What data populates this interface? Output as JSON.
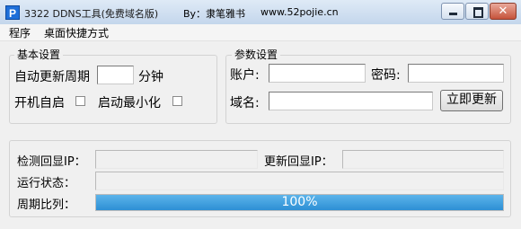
{
  "window": {
    "icon_letter": "P",
    "title": "3322 DDNS工具(免费域名版)",
    "author": "By：隶笔雅书",
    "url": "www.52pojie.cn",
    "close_glyph": "✕"
  },
  "menu": {
    "items": [
      "程序",
      "桌面快捷方式"
    ]
  },
  "basic": {
    "title": "基本设置",
    "update_period_label": "自动更新周期",
    "update_period_value": "",
    "minute_unit": "分钟",
    "autostart_label": "开机自启",
    "autostart_checked": false,
    "minimize_label": "启动最小化",
    "minimize_checked": false
  },
  "params": {
    "title": "参数设置",
    "account_label": "账户:",
    "account_value": "",
    "password_label": "密码:",
    "password_value": "",
    "domain_label": "域名:",
    "domain_value": "",
    "update_button": "立即更新"
  },
  "status": {
    "detect_ip_label": "检测回显IP：",
    "detect_ip_value": "",
    "update_ip_label": "更新回显IP：",
    "update_ip_value": "",
    "run_status_label": "运行状态：",
    "run_status_value": "",
    "period_ratio_label": "周期比列：",
    "progress_text": "100%",
    "progress_percent": 100
  }
}
